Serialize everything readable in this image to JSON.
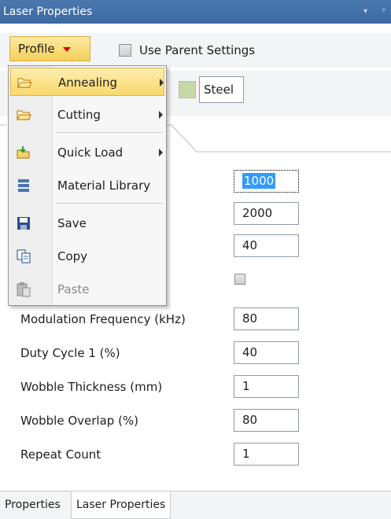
{
  "window": {
    "title": "Laser Properties",
    "controls": [
      "▾",
      "ᵖ"
    ]
  },
  "toolbar": {
    "profile_label": "Profile",
    "use_parent_label": "Use Parent Settings",
    "use_parent_checked": false
  },
  "material": {
    "name": "Steel",
    "swatch_color": "#c7d7a8"
  },
  "menu": {
    "items": [
      {
        "label": "Annealing",
        "icon": "folder-open-icon",
        "submenu": true,
        "highlighted": true
      },
      {
        "label": "Cutting",
        "icon": "folder-open-icon",
        "submenu": true
      },
      {
        "label": "Quick Load",
        "icon": "folder-load-icon",
        "submenu": true
      },
      {
        "label": "Material Library",
        "icon": "library-icon"
      },
      {
        "label": "Save",
        "icon": "save-icon"
      },
      {
        "label": "Copy",
        "icon": "copy-icon"
      },
      {
        "label": "Paste",
        "icon": "paste-icon",
        "disabled": true
      }
    ]
  },
  "fields": {
    "hidden1_value": "1000",
    "hidden2_value": "2000",
    "hidden3_value": "40",
    "hidden_checkbox_checked": false
  },
  "properties": [
    {
      "label": "Modulation Frequency (kHz)",
      "value": "80"
    },
    {
      "label": "Duty Cycle 1 (%)",
      "value": "40"
    },
    {
      "label": "Wobble Thickness (mm)",
      "value": "1"
    },
    {
      "label": "Wobble Overlap (%)",
      "value": "80"
    },
    {
      "label": "Repeat Count",
      "value": "1"
    }
  ],
  "bottom_tabs": [
    {
      "label": "Properties",
      "active": false
    },
    {
      "label": "Laser Properties",
      "active": true
    }
  ],
  "colors": {
    "title_bg": "#3c6aa1",
    "highlight": "#f9d86b",
    "selection": "#3399ff"
  }
}
